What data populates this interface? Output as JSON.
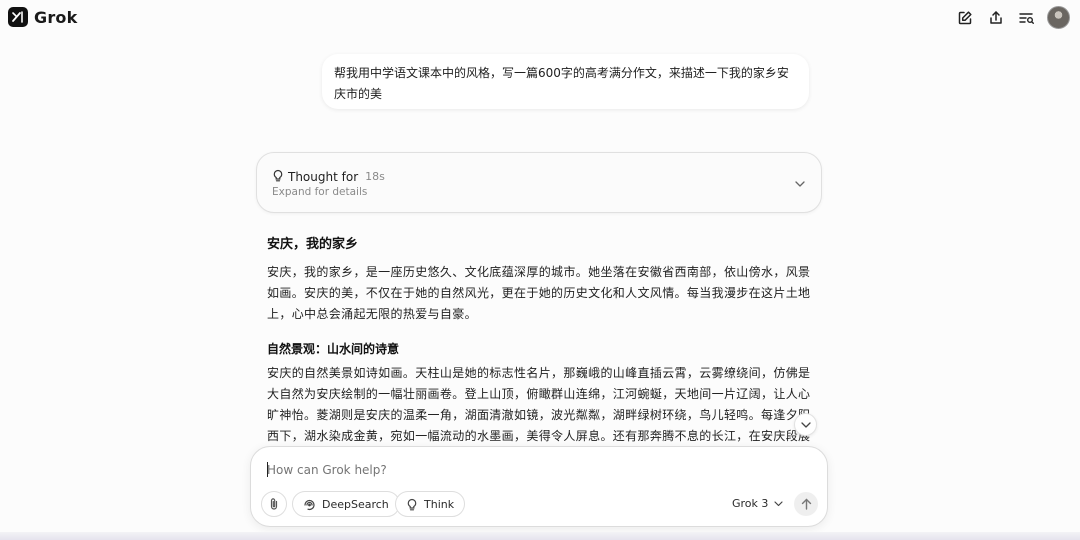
{
  "app": {
    "name": "Grok"
  },
  "conversation": {
    "user_message": "帮我用中学语文课本中的风格，写一篇600字的高考满分作文，来描述一下我的家乡安庆市的美",
    "thought": {
      "title": "Thought for",
      "duration": "18s",
      "subtitle": "Expand for details"
    },
    "response": {
      "title": "安庆，我的家乡",
      "intro": "安庆，我的家乡，是一座历史悠久、文化底蕴深厚的城市。她坐落在安徽省西南部，依山傍水，风景如画。安庆的美，不仅在于她的自然风光，更在于她的历史文化和人文风情。每当我漫步在这片土地上，心中总会涌起无限的热爱与自豪。",
      "section1_heading": "自然景观：山水间的诗意",
      "section1_text": "安庆的自然美景如诗如画。天柱山是她的标志性名片，那巍峨的山峰直插云霄，云雾缭绕间，仿佛是大自然为安庆绘制的一幅壮丽画卷。登上山顶，俯瞰群山连绵，江河蜿蜒，天地间一片辽阔，让人心旷神怡。菱湖则是安庆的温柔一角，湖面清澈如镜，波光粼粼，湖畔绿树环绕，鸟儿轻鸣。每逢夕阳西下，湖水染成金黄，宛如一幅流动的水墨画，美得令人屏息。还有那奔腾不息的长江，在安庆段展现出无比的壮"
    }
  },
  "composer": {
    "placeholder": "How can Grok help?",
    "deepsearch_label": "DeepSearch",
    "think_label": "Think",
    "model_label": "Grok 3"
  },
  "icons": {
    "logo": "grok-logo-icon",
    "new_chat": "edit-icon",
    "share": "share-icon",
    "history": "history-icon",
    "thought": "lightbulb-icon",
    "attach": "paperclip-icon",
    "deepsearch": "deepsearch-icon",
    "think": "lightbulb-icon",
    "send": "arrow-up-icon"
  },
  "colors": {
    "background": "#fcfcfc",
    "surface": "#ffffff",
    "border": "#dedede",
    "muted_text": "#8a8a8a"
  }
}
